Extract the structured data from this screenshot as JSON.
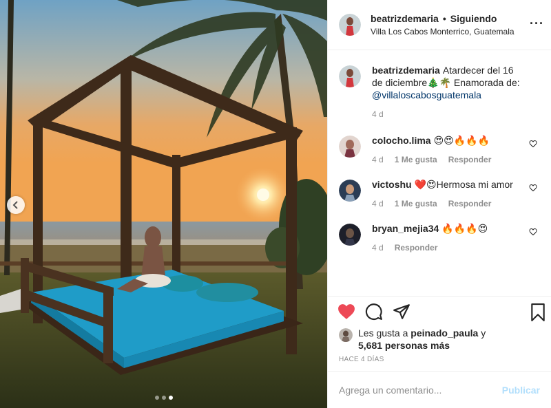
{
  "post": {
    "username": "beatrizdemaria",
    "separator": "•",
    "follow_status": "Siguiendo",
    "location": "Villa Los Cabos Monterrico, Guatemala",
    "more_icon": "more-options-icon",
    "carousel": {
      "total_slides": 3,
      "active_slide": 3
    }
  },
  "caption": {
    "username": "beatrizdemaria",
    "text": "Atardecer del 16 de diciembre🎄🌴 Enamorada de: ",
    "mention": "@villaloscabosguatemala",
    "time": "4 d"
  },
  "comments": [
    {
      "username": "colocho.lima",
      "text": "😍😍🔥🔥🔥",
      "time": "4 d",
      "likes": "1 Me gusta",
      "reply": "Responder"
    },
    {
      "username": "victoshu",
      "text": "❤️😍Hermosa mi amor",
      "time": "4 d",
      "likes": "1 Me gusta",
      "reply": "Responder"
    },
    {
      "username": "bryan_mejia34",
      "text": "🔥🔥🔥😍",
      "time": "4 d",
      "likes": "",
      "reply": "Responder"
    }
  ],
  "likes": {
    "prefix": "Les gusta a ",
    "user": "peinado_paula",
    "middle": " y",
    "others": "5,681 personas más"
  },
  "posted": "HACE 4 DÍAS",
  "add_comment": {
    "placeholder": "Agrega un comentario...",
    "publish": "Publicar"
  },
  "colors": {
    "like_red": "#ed4956",
    "link_blue": "#003569",
    "publish_blue": "#b2dffc",
    "muted": "#8e8e8e"
  }
}
